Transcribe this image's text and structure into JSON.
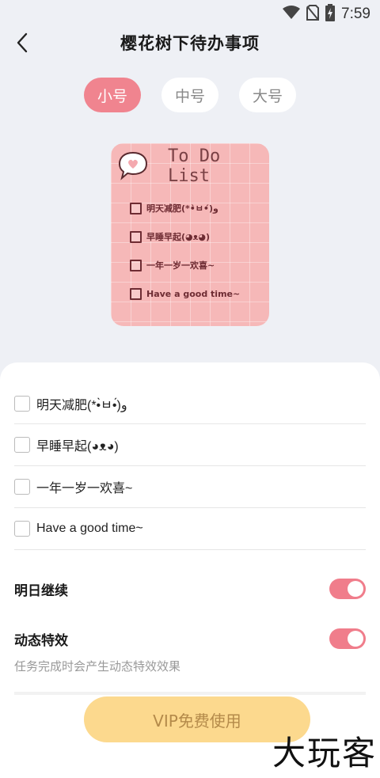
{
  "status_bar": {
    "time": "7:59"
  },
  "header": {
    "title": "樱花树下待办事项"
  },
  "size_tabs": [
    {
      "label": "小号",
      "active": true
    },
    {
      "label": "中号",
      "active": false
    },
    {
      "label": "大号",
      "active": false
    }
  ],
  "preview": {
    "title": "To Do List",
    "items": [
      "明天减肥(*•̀ㅂ•́)و",
      "早睡早起(◕ᴥ◕)",
      "一年一岁一欢喜~",
      "Have a good time~"
    ]
  },
  "todos": [
    {
      "text": "明天减肥(*•̀ㅂ•́)و"
    },
    {
      "text": "早睡早起(◕ᴥ◕)"
    },
    {
      "text": "一年一岁一欢喜~"
    },
    {
      "text": "Have a good time~"
    }
  ],
  "settings": {
    "continue_label": "明日继续",
    "continue_on": true,
    "effect_label": "动态特效",
    "effect_on": true,
    "effect_desc": "任务完成时会产生动态特效效果"
  },
  "vip_button": "VIP免费使用",
  "watermark": "大玩客",
  "colors": {
    "accent": "#f0848f",
    "vip": "#fcd98e",
    "preview_bg": "#f6b8b8"
  }
}
